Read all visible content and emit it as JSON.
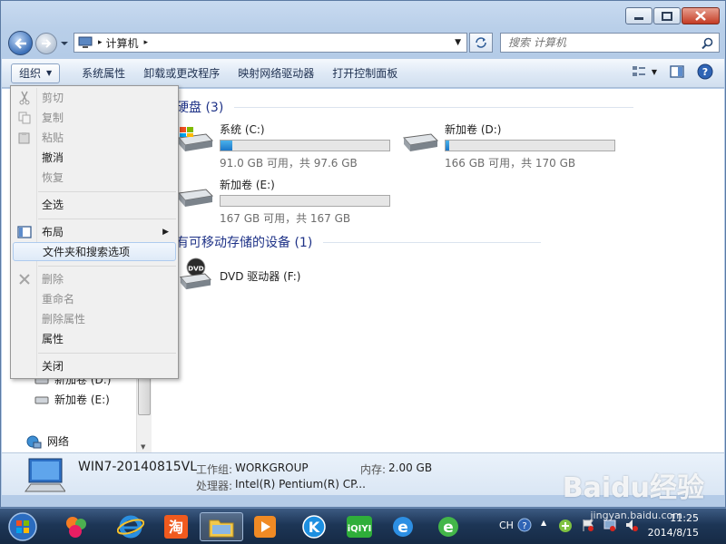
{
  "window": {
    "breadcrumb": "计算机",
    "search_placeholder": "搜索 计算机"
  },
  "toolbar": {
    "organize": "组织",
    "system_properties": "系统属性",
    "uninstall": "卸载或更改程序",
    "map_drive": "映射网络驱动器",
    "control_panel": "打开控制面板"
  },
  "main": {
    "hdd_group": "硬盘 (3)",
    "removable_group": "有可移动存储的设备 (1)",
    "drives": [
      {
        "name": "系统 (C:)",
        "free": "91.0 GB 可用，共 97.6 GB",
        "used_fraction": 0.07
      },
      {
        "name": "新加卷 (D:)",
        "free": "166 GB 可用，共 170 GB",
        "used_fraction": 0.02
      },
      {
        "name": "新加卷 (E:)",
        "free": "167 GB 可用，共 167 GB",
        "used_fraction": 0.0
      }
    ],
    "dvd": "DVD 驱动器 (F:)"
  },
  "navpane": {
    "item_d": "新加卷 (D:)",
    "item_e": "新加卷 (E:)",
    "network": "网络"
  },
  "menu": {
    "cut": "剪切",
    "copy": "复制",
    "paste": "粘贴",
    "undo": "撤消",
    "redo": "恢复",
    "select_all": "全选",
    "layout": "布局",
    "folder_options": "文件夹和搜索选项",
    "delete": "删除",
    "rename": "重命名",
    "remove_props": "删除属性",
    "properties": "属性",
    "close": "关闭"
  },
  "details": {
    "computer_name": "WIN7-20140815VL",
    "workgroup_label": "工作组:",
    "workgroup": "WORKGROUP",
    "memory_label": "内存:",
    "memory": "2.00 GB",
    "processor_label": "处理器:",
    "processor": "Intel(R) Pentium(R) CP..."
  },
  "taskbar": {
    "lang": "CH",
    "time": "11:25",
    "date": "2014/8/15"
  },
  "watermark": {
    "logo": "Baidu经验",
    "url": "jingyan.baidu.com"
  }
}
